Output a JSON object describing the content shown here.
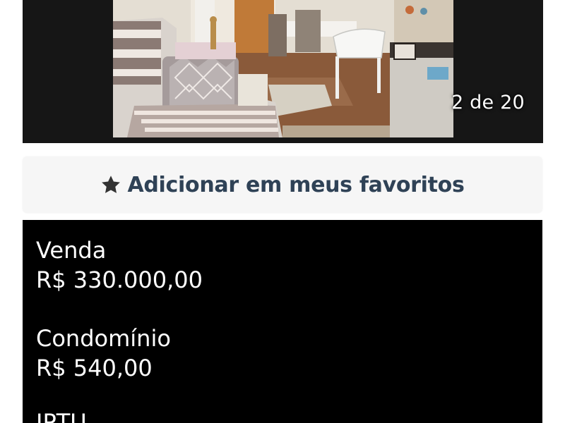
{
  "gallery": {
    "photo_alt": "Foto do imóvel: sala de estar e jantar",
    "counter": "2 de 20"
  },
  "favorites": {
    "label": "Adicionar em meus favoritos",
    "icon": "star-icon"
  },
  "details": [
    {
      "label": "Venda",
      "value": "R$ 330.000,00"
    },
    {
      "label": "Condomínio",
      "value": "R$ 540,00"
    },
    {
      "label": "IPTU",
      "value": ""
    }
  ],
  "colors": {
    "gallery_bg": "#161616",
    "panel_bg": "#000000",
    "button_bg": "#f6f6f6",
    "button_text": "#2f4256"
  }
}
